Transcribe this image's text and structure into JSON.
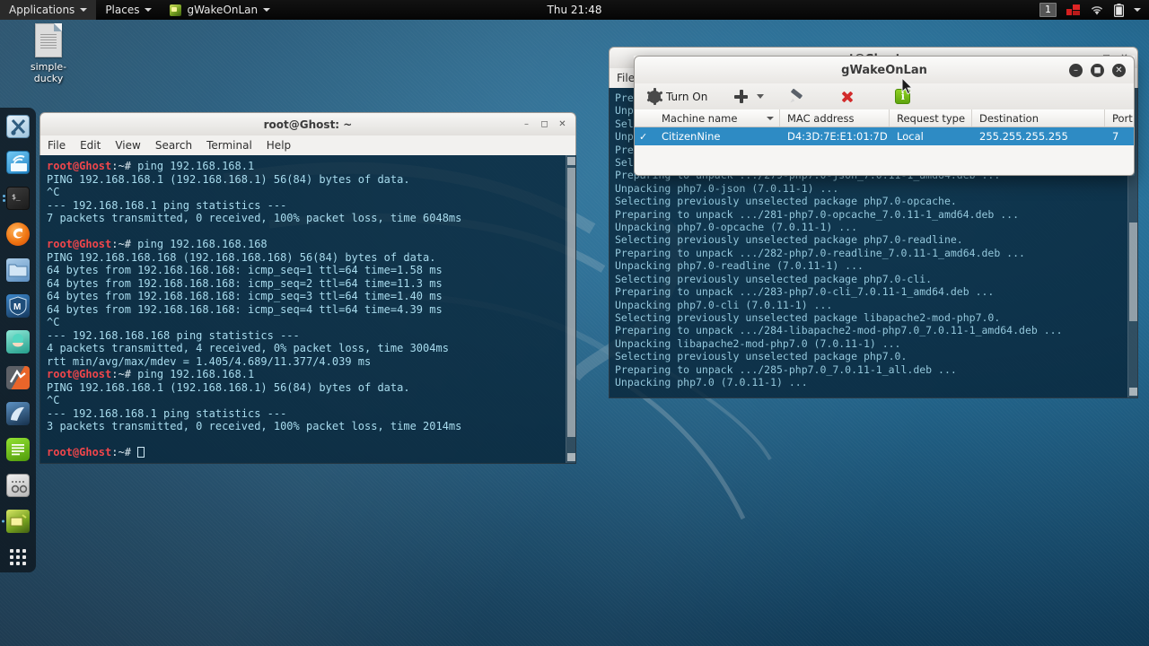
{
  "panel": {
    "applications_label": "Applications",
    "places_label": "Places",
    "active_app_label": "gWakeOnLan",
    "clock": "Thu 21:48",
    "workspace": "1",
    "tray_icons": [
      "workspace-pager",
      "notification-icon",
      "network-wifi-icon",
      "battery-icon",
      "system-menu-caret"
    ]
  },
  "desktop": {
    "icon_label_line1": "simple-",
    "icon_label_line2": "ducky",
    "icon_name": "simple-ducky"
  },
  "dock": {
    "items": [
      {
        "name": "tools-icon",
        "colors": [
          "#dff1fb",
          "#3f7fa8"
        ]
      },
      {
        "name": "wireless-attack-icon",
        "colors": [
          "#63c0f2",
          "#1c7fc0"
        ]
      },
      {
        "name": "terminal-icon",
        "colors": [
          "#3a3a3a",
          "#1f1f1f"
        ]
      },
      {
        "name": "firefox-icon",
        "colors": [
          "#ff8a28",
          "#e8590c"
        ]
      },
      {
        "name": "file-manager-icon",
        "colors": [
          "#9fc6e8",
          "#5a8fc0"
        ]
      },
      {
        "name": "metasploit-icon",
        "colors": [
          "#2a6fb5",
          "#173f6e"
        ]
      },
      {
        "name": "burpsuite-icon",
        "colors": [
          "#6fe3d2",
          "#27a08f"
        ]
      },
      {
        "name": "beef-icon",
        "colors": [
          "#e8632a",
          "#5a5a5a"
        ]
      },
      {
        "name": "maltego-icon",
        "colors": [
          "#6fa8d4",
          "#1e3f5e"
        ]
      },
      {
        "name": "text-editor-icon",
        "colors": [
          "#7ed321",
          "#4f9a0a"
        ]
      },
      {
        "name": "wireshark-icon",
        "colors": [
          "#e9e9e9",
          "#b8b8b8"
        ]
      },
      {
        "name": "gwakeonlan-icon",
        "colors": [
          "#cfe05a",
          "#6f9a1e"
        ]
      }
    ],
    "show_apps_label": "show-applications"
  },
  "background_terminal": {
    "title": "root@Ghost: ~",
    "menu": [
      "File"
    ],
    "lines": [
      "Preparing to unpack .../280-php7.0-json_7.0.11-1_amd64.deb ...",
      "Unpacking php7.0-json (7.0.11-1) ...",
      "Selecting previously unselected package php7.0-opcache.",
      "Unpacking php7.0-opcache (7.0.11-1) ...",
      "Preparing to unpack .../281-php7.0-opcache_7.0.11-1_amd64.deb ...",
      "Selecting previously unselected package php7.0-opcache.",
      "Preparing to unpack .../279-php7.0-json_7.0.11-1_amd64.deb ...",
      "Unpacking php7.0-json (7.0.11-1) ...",
      "Selecting previously unselected package php7.0-opcache.",
      "Preparing to unpack .../281-php7.0-opcache_7.0.11-1_amd64.deb ...",
      "Unpacking php7.0-opcache (7.0.11-1) ...",
      "Selecting previously unselected package php7.0-readline.",
      "Preparing to unpack .../282-php7.0-readline_7.0.11-1_amd64.deb ...",
      "Unpacking php7.0-readline (7.0.11-1) ...",
      "Selecting previously unselected package php7.0-cli.",
      "Preparing to unpack .../283-php7.0-cli_7.0.11-1_amd64.deb ...",
      "Unpacking php7.0-cli (7.0.11-1) ...",
      "Selecting previously unselected package libapache2-mod-php7.0.",
      "Preparing to unpack .../284-libapache2-mod-php7.0_7.0.11-1_amd64.deb ...",
      "Unpacking libapache2-mod-php7.0 (7.0.11-1) ...",
      "Selecting previously unselected package php7.0.",
      "Preparing to unpack .../285-php7.0_7.0.11-1_all.deb ...",
      "Unpacking php7.0 (7.0.11-1) ..."
    ]
  },
  "terminal": {
    "title": "root@Ghost: ~",
    "menu": [
      "File",
      "Edit",
      "View",
      "Search",
      "Terminal",
      "Help"
    ],
    "prompt_user": "root@Ghost",
    "prompt_path": ":~# ",
    "lines": [
      {
        "type": "cmd",
        "text": "ping 192.168.168.1"
      },
      {
        "type": "out",
        "text": "PING 192.168.168.1 (192.168.168.1) 56(84) bytes of data."
      },
      {
        "type": "out",
        "text": "^C"
      },
      {
        "type": "out",
        "text": "--- 192.168.168.1 ping statistics ---"
      },
      {
        "type": "out",
        "text": "7 packets transmitted, 0 received, 100% packet loss, time 6048ms"
      },
      {
        "type": "blank",
        "text": ""
      },
      {
        "type": "cmd",
        "text": "ping 192.168.168.168"
      },
      {
        "type": "out",
        "text": "PING 192.168.168.168 (192.168.168.168) 56(84) bytes of data."
      },
      {
        "type": "out",
        "text": "64 bytes from 192.168.168.168: icmp_seq=1 ttl=64 time=1.58 ms"
      },
      {
        "type": "out",
        "text": "64 bytes from 192.168.168.168: icmp_seq=2 ttl=64 time=11.3 ms"
      },
      {
        "type": "out",
        "text": "64 bytes from 192.168.168.168: icmp_seq=3 ttl=64 time=1.40 ms"
      },
      {
        "type": "out",
        "text": "64 bytes from 192.168.168.168: icmp_seq=4 ttl=64 time=4.39 ms"
      },
      {
        "type": "out",
        "text": "^C"
      },
      {
        "type": "out",
        "text": "--- 192.168.168.168 ping statistics ---"
      },
      {
        "type": "out",
        "text": "4 packets transmitted, 4 received, 0% packet loss, time 3004ms"
      },
      {
        "type": "out",
        "text": "rtt min/avg/max/mdev = 1.405/4.689/11.377/4.039 ms"
      },
      {
        "type": "cmd",
        "text": "ping 192.168.168.1"
      },
      {
        "type": "out",
        "text": "PING 192.168.168.1 (192.168.168.1) 56(84) bytes of data."
      },
      {
        "type": "out",
        "text": "^C"
      },
      {
        "type": "out",
        "text": "--- 192.168.168.1 ping statistics ---"
      },
      {
        "type": "out",
        "text": "3 packets transmitted, 0 received, 100% packet loss, time 2014ms"
      },
      {
        "type": "blank",
        "text": ""
      },
      {
        "type": "prompt",
        "text": ""
      }
    ]
  },
  "gwakeonlan": {
    "title": "gWakeOnLan",
    "toolbar": {
      "turn_on_label": "Turn On",
      "add_label": "add-machine",
      "add_dropdown_label": "add-options",
      "edit_label": "edit-machine",
      "delete_label": "delete-machine",
      "about_label": "i"
    },
    "columns": [
      {
        "label": "Machine name",
        "width": 140,
        "sorted": true
      },
      {
        "label": "MAC address",
        "width": 122,
        "sorted": false
      },
      {
        "label": "Request type",
        "width": 92,
        "sorted": false
      },
      {
        "label": "Destination",
        "width": 148,
        "sorted": false
      },
      {
        "label": "Port NR",
        "width": 54,
        "sorted": false
      }
    ],
    "rows": [
      {
        "checked": true,
        "machine_name": "CitizenNine",
        "mac_address": "D4:3D:7E:E1:01:7D",
        "request_type": "Local",
        "destination": "255.255.255.255",
        "port_nr": "7"
      }
    ],
    "selection_color": "#2e8bc4"
  },
  "colors": {
    "desktop_accent": "#1b5274",
    "terminal_text": "#a8dcee",
    "prompt_red": "#f0464b",
    "selection_blue": "#2e8bc4",
    "panel_bg": "#0a0a0a"
  }
}
